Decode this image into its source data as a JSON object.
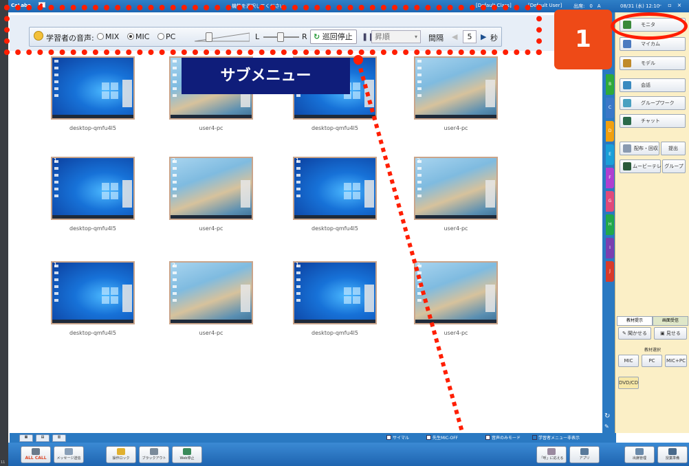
{
  "app": {
    "title": "CaLabo",
    "title_message": "機能を選択してください。",
    "class_name": "[Default Class]",
    "user_name": "[Default User]",
    "attendance": "出席:　0　A",
    "datetime": "08/31 (水) 12:10",
    "left_strip_num": "11"
  },
  "toolbar": {
    "voice_label": "学習者の音声:",
    "voice_options": [
      "MIX",
      "MIC",
      "PC"
    ],
    "voice_selected": "MIC",
    "balance_left": "L",
    "balance_right": "R",
    "tour_stop_label": "巡回停止",
    "sort_value": "昇順",
    "interval_label": "間隔",
    "interval_value": "5",
    "interval_unit": "秒"
  },
  "callout": {
    "submenu_label": "サブメニュー",
    "badge_number": "1"
  },
  "thumbnails": [
    {
      "label": "desktop-qmfu4l5",
      "kind": "win",
      "index": ""
    },
    {
      "label": "user4-pc",
      "kind": "wave",
      "index": ""
    },
    {
      "label": "desktop-qmfu4l5",
      "kind": "win",
      "index": ""
    },
    {
      "label": "user4-pc",
      "kind": "wave",
      "index": ""
    },
    {
      "label": "desktop-qmfu4l5",
      "kind": "win",
      "index": "1"
    },
    {
      "label": "user4-pc",
      "kind": "wave",
      "index": "2"
    },
    {
      "label": "desktop-qmfu4l5",
      "kind": "win",
      "index": "1"
    },
    {
      "label": "user4-pc",
      "kind": "wave",
      "index": "2"
    },
    {
      "label": "desktop-qmfu4l5",
      "kind": "win",
      "index": "1"
    },
    {
      "label": "user4-pc",
      "kind": "wave",
      "index": "2"
    },
    {
      "label": "desktop-qmfu4l5",
      "kind": "win",
      "index": "1"
    },
    {
      "label": "user4-pc",
      "kind": "wave",
      "index": "2"
    }
  ],
  "color_tabs": [
    {
      "label": "B",
      "color": "#2faa3a"
    },
    {
      "label": "C",
      "color": "#3a78c8"
    },
    {
      "label": "D",
      "color": "#f0a010"
    },
    {
      "label": "E",
      "color": "#1aa0d8"
    },
    {
      "label": "F",
      "color": "#b03fd0"
    },
    {
      "label": "G",
      "color": "#e04a7a"
    },
    {
      "label": "H",
      "color": "#22a84a"
    },
    {
      "label": "I",
      "color": "#7a3fb0"
    },
    {
      "label": "J",
      "color": "#d83a2a"
    }
  ],
  "right_panel": {
    "buttons": [
      {
        "label": "モニタ",
        "color": "#3a8a3a"
      },
      {
        "label": "マイカム",
        "color": "#4a7ac0"
      },
      {
        "label": "モデル",
        "color": "#c08a2a"
      },
      {
        "label": "会話",
        "color": "#3a8ac0"
      },
      {
        "label": "グループワーク",
        "color": "#4aa0c0"
      },
      {
        "label": "チャット",
        "color": "#2a6a4a"
      }
    ],
    "distribute_label": "配布・回収",
    "submit_label": "提出",
    "movie_label": "ムービーテレコ",
    "group_label": "グループ",
    "tab_material": "教材提示",
    "tab_screen": "画面受信",
    "listen_label": "聞かせる",
    "show_label": "見せる",
    "material_select": "教材選択",
    "src_mic": "MIC",
    "src_pc": "PC",
    "src_micpc": "MIC+PC",
    "dvd_label": "DVD/CD"
  },
  "status": {
    "simul": "サイマル",
    "teacher_mic_off": "先生MIC-OFF",
    "audio_only": "音声のみモード",
    "hide_learner_menu": "学習者メニュー非表示"
  },
  "bottom_buttons": {
    "all_call": "ALL CALL",
    "message": "メッセージ送信",
    "lock": "操作ロック",
    "blackout": "ブラックアウト",
    "web_stop": "Web停止",
    "call_response": "「呼」に応える",
    "apps": "アプリ",
    "attendance": "出席管理",
    "record": "授業準備"
  }
}
